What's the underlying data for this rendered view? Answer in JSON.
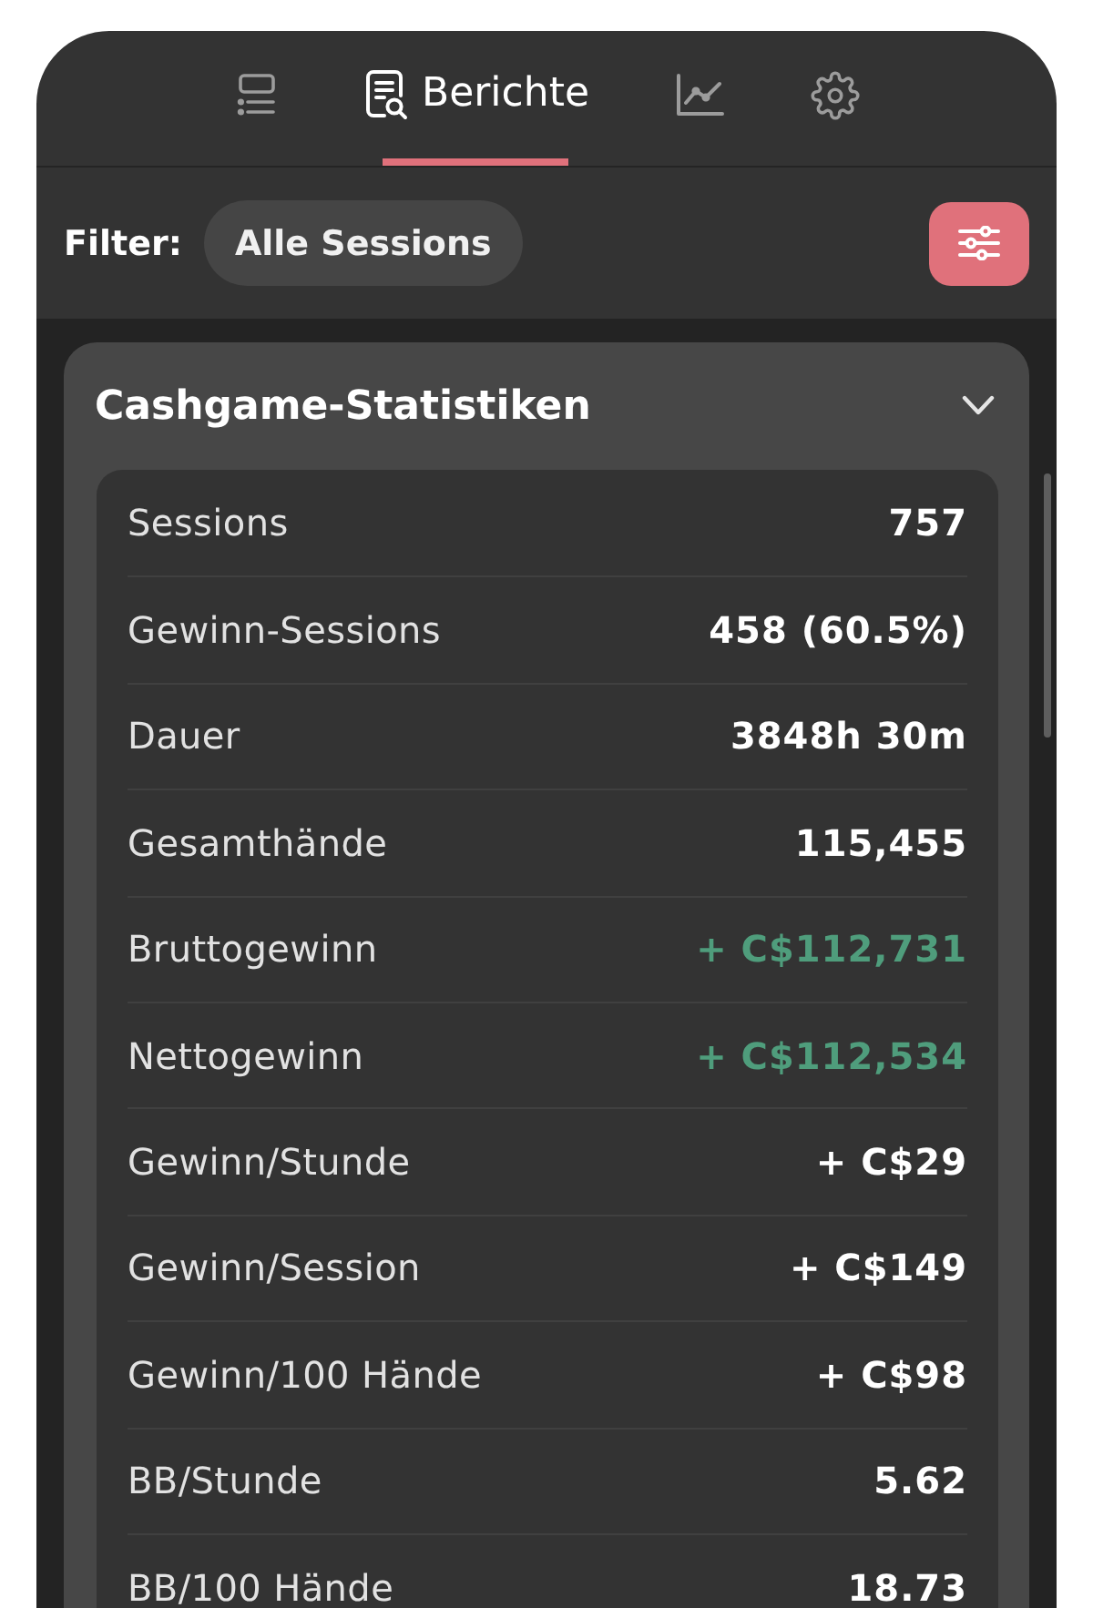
{
  "tabs": [
    {
      "kind": "list",
      "selected": false
    },
    {
      "kind": "report",
      "label": "Berichte",
      "selected": true
    },
    {
      "kind": "chart",
      "selected": false
    },
    {
      "kind": "settings",
      "selected": false
    }
  ],
  "filter": {
    "label": "Filter:",
    "chip": "Alle Sessions"
  },
  "section": {
    "title": "Cashgame-Statistiken",
    "expanded": true,
    "rows": [
      {
        "label": "Sessions",
        "value": "757",
        "highlighted": false
      },
      {
        "label": "Gewinn-Sessions",
        "value": "458 (60.5%)",
        "highlighted": false
      },
      {
        "label": "Dauer",
        "value": "3848h 30m",
        "highlighted": false
      },
      {
        "label": "Gesamthände",
        "value": "115,455",
        "highlighted": false
      },
      {
        "label": "Bruttogewinn",
        "value": "+ C$112,731",
        "highlighted": true
      },
      {
        "label": "Nettogewinn",
        "value": "+ C$112,534",
        "highlighted": true
      },
      {
        "label": "Gewinn/Stunde",
        "value": "+ C$29",
        "highlighted": false
      },
      {
        "label": "Gewinn/Session",
        "value": "+ C$149",
        "highlighted": false
      },
      {
        "label": "Gewinn/100 Hände",
        "value": "+ C$98",
        "highlighted": false
      },
      {
        "label": "BB/Stunde",
        "value": "5.62",
        "highlighted": false
      },
      {
        "label": "BB/100 Hände",
        "value": "18.73",
        "highlighted": false
      }
    ]
  }
}
